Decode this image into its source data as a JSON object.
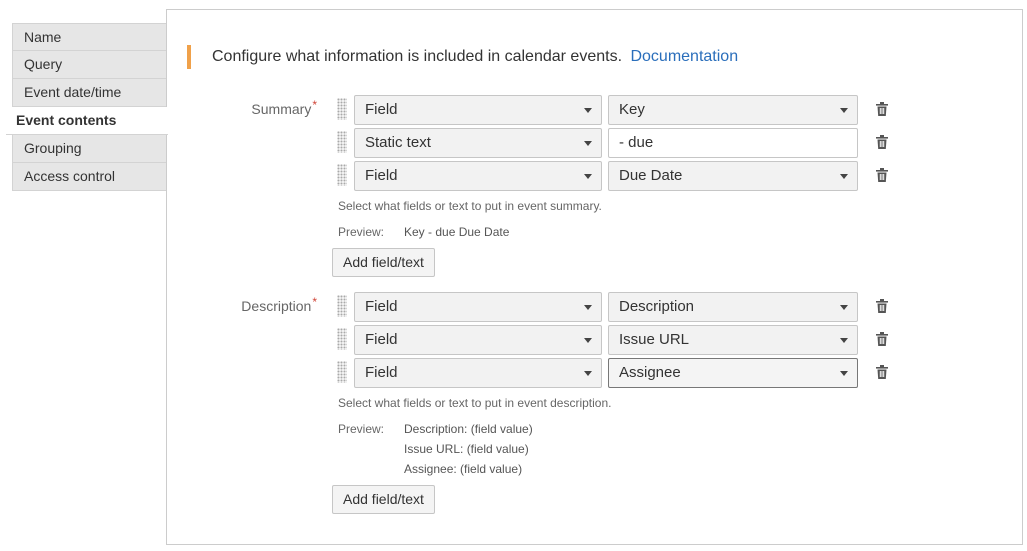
{
  "sidebar": {
    "items": [
      {
        "label": "Name"
      },
      {
        "label": "Query"
      },
      {
        "label": "Event date/time"
      },
      {
        "label": "Event contents"
      },
      {
        "label": "Grouping"
      },
      {
        "label": "Access control"
      }
    ],
    "active_index": 3
  },
  "info": {
    "text": "Configure what information is included in calendar events.",
    "link": "Documentation",
    "accent_color": "#f0a14a"
  },
  "summary": {
    "label": "Summary",
    "required_mark": "*",
    "rows": [
      {
        "type": "Field",
        "value": "Key",
        "value_kind": "select"
      },
      {
        "type": "Static text",
        "value": "- due",
        "value_kind": "text"
      },
      {
        "type": "Field",
        "value": "Due Date",
        "value_kind": "select"
      }
    ],
    "hint": "Select what fields or text to put in event summary.",
    "preview_label": "Preview:",
    "preview_lines": [
      "Key - due Due Date"
    ],
    "add_button": "Add field/text"
  },
  "description": {
    "label": "Description",
    "required_mark": "*",
    "rows": [
      {
        "type": "Field",
        "value": "Description",
        "value_kind": "select"
      },
      {
        "type": "Field",
        "value": "Issue URL",
        "value_kind": "select"
      },
      {
        "type": "Field",
        "value": "Assignee",
        "value_kind": "select"
      }
    ],
    "hint": "Select what fields or text to put in event description.",
    "preview_label": "Preview:",
    "preview_lines": [
      "Description: (field value)",
      "Issue URL: (field value)",
      "Assignee: (field value)"
    ],
    "add_button": "Add field/text"
  },
  "icons": {
    "drag": "drag-handle-icon",
    "delete": "trash-icon",
    "dropdown": "chevron-down-icon"
  }
}
